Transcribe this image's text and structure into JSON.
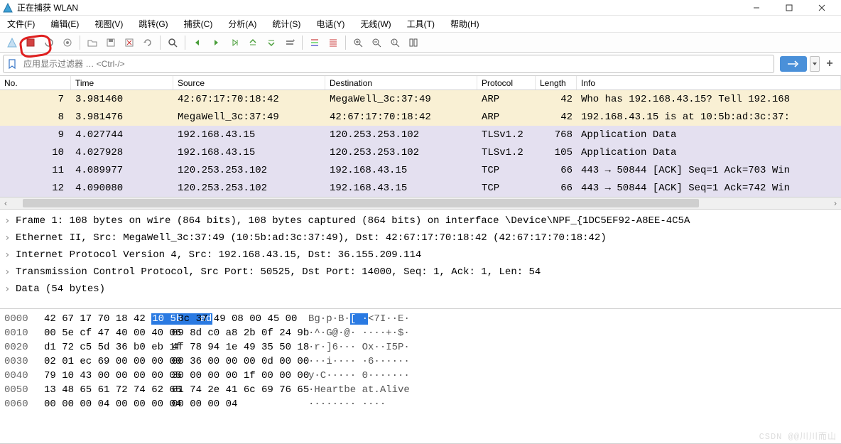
{
  "title": "正在捕获 WLAN",
  "menu": {
    "file": "文件(F)",
    "edit": "编辑(E)",
    "view": "视图(V)",
    "go": "跳转(G)",
    "capture": "捕获(C)",
    "analyze": "分析(A)",
    "statistics": "统计(S)",
    "telephony": "电话(Y)",
    "wireless": "无线(W)",
    "tools": "工具(T)",
    "help": "帮助(H)"
  },
  "filter_placeholder": "应用显示过滤器 … <Ctrl-/>",
  "columns": {
    "no": "No.",
    "time": "Time",
    "source": "Source",
    "destination": "Destination",
    "protocol": "Protocol",
    "length": "Length",
    "info": "Info"
  },
  "packets": [
    {
      "no": "7",
      "time": "3.981460",
      "src": "42:67:17:70:18:42",
      "dst": "MegaWell_3c:37:49",
      "proto": "ARP",
      "len": "42",
      "info": "Who has 192.168.43.15? Tell 192.168",
      "cls": "arp"
    },
    {
      "no": "8",
      "time": "3.981476",
      "src": "MegaWell_3c:37:49",
      "dst": "42:67:17:70:18:42",
      "proto": "ARP",
      "len": "42",
      "info": "192.168.43.15 is at 10:5b:ad:3c:37:",
      "cls": "arp"
    },
    {
      "no": "9",
      "time": "4.027744",
      "src": "192.168.43.15",
      "dst": "120.253.253.102",
      "proto": "TLSv1.2",
      "len": "768",
      "info": "Application Data",
      "cls": "tls"
    },
    {
      "no": "10",
      "time": "4.027928",
      "src": "192.168.43.15",
      "dst": "120.253.253.102",
      "proto": "TLSv1.2",
      "len": "105",
      "info": "Application Data",
      "cls": "tls"
    },
    {
      "no": "11",
      "time": "4.089977",
      "src": "120.253.253.102",
      "dst": "192.168.43.15",
      "proto": "TCP",
      "len": "66",
      "info": "443 → 50844 [ACK] Seq=1 Ack=703 Win",
      "cls": "tcp"
    },
    {
      "no": "12",
      "time": "4.090080",
      "src": "120.253.253.102",
      "dst": "192.168.43.15",
      "proto": "TCP",
      "len": "66",
      "info": "443 → 50844 [ACK] Seq=1 Ack=742 Win",
      "cls": "tcp"
    }
  ],
  "details": [
    "Frame 1: 108 bytes on wire (864 bits), 108 bytes captured (864 bits) on interface \\Device\\NPF_{1DC5EF92-A8EE-4C5A",
    "Ethernet II, Src: MegaWell_3c:37:49 (10:5b:ad:3c:37:49), Dst: 42:67:17:70:18:42 (42:67:17:70:18:42)",
    "Internet Protocol Version 4, Src: 192.168.43.15, Dst: 36.155.209.114",
    "Transmission Control Protocol, Src Port: 50525, Dst Port: 14000, Seq: 1, Ack: 1, Len: 54",
    "Data (54 bytes)"
  ],
  "hex": [
    {
      "off": "0000",
      "b1": "42 67 17 70 18 42 ",
      "sel": "10 5b   ad",
      "b1b": " 3c 37 49 08 00 45 00",
      "asc_pre": "Bg·p·B·",
      "asc_sel": "[ ·",
      "asc_post": "<7I··E·"
    },
    {
      "off": "0010",
      "b1": "00 5e cf 47 40 00 40 06",
      "b2": "89 8d c0 a8 2b 0f 24 9b",
      "asc": "·^·G@·@· ····+·$·"
    },
    {
      "off": "0020",
      "b1": "d1 72 c5 5d 36 b0 eb 1f",
      "b2": "4f 78 94 1e 49 35 50 18",
      "asc": "·r·]6··· Ox··I5P·"
    },
    {
      "off": "0030",
      "b1": "02 01 ec 69 00 00 00 00",
      "b2": "00 36 00 00 00 0d 00 00",
      "asc": "···i···· ·6······"
    },
    {
      "off": "0040",
      "b1": "79 10 43 00 00 00 00 05",
      "b2": "30 00 00 00 1f 00 00 00",
      "asc": "y·C····· 0·······"
    },
    {
      "off": "0050",
      "b1": "13 48 65 61 72 74 62 65",
      "b2": "61 74 2e 41 6c 69 76 65",
      "asc": "·Heartbe at.Alive"
    },
    {
      "off": "0060",
      "b1": "00 00 00 04 00 00 00 04",
      "b2": "00 00 00 04",
      "asc": "········ ····"
    }
  ],
  "watermark": "CSDN @@川川而山"
}
